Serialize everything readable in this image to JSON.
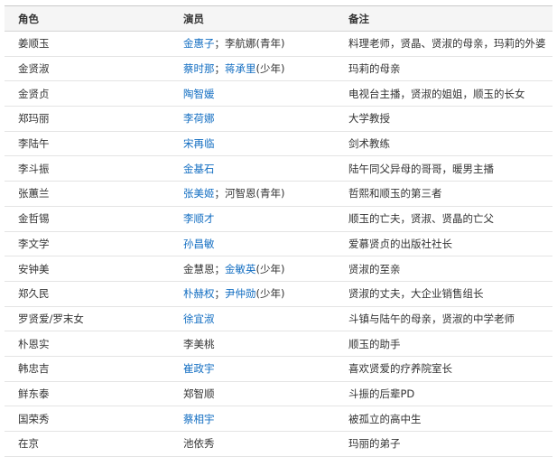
{
  "headers": [
    "角色",
    "演员",
    "备注"
  ],
  "colors": {
    "link": "#136ec2",
    "text": "#333333",
    "header_bg": "#f5f5f5",
    "line": "#e4e4e4"
  },
  "rows": [
    {
      "role": "姜顺玉",
      "actors": [
        {
          "text": "金惠子",
          "link": true
        },
        {
          "text": "；李航娜(青年)",
          "link": false
        }
      ],
      "note": "料理老师，贤晶、贤淑的母亲，玛莉的外婆"
    },
    {
      "role": "金贤淑",
      "actors": [
        {
          "text": "蔡时那",
          "link": true
        },
        {
          "text": "；",
          "link": false
        },
        {
          "text": "蒋承里",
          "link": true
        },
        {
          "text": "(少年)",
          "link": false
        }
      ],
      "note": "玛莉的母亲"
    },
    {
      "role": "金贤贞",
      "actors": [
        {
          "text": "陶智媛",
          "link": true
        }
      ],
      "note": "电视台主播，贤淑的姐姐，顺玉的长女"
    },
    {
      "role": "郑玛丽",
      "actors": [
        {
          "text": "李荷娜",
          "link": true
        }
      ],
      "note": "大学教授"
    },
    {
      "role": "李陆午",
      "actors": [
        {
          "text": "宋再临",
          "link": true
        }
      ],
      "note": "剑术教练"
    },
    {
      "role": "李斗振",
      "actors": [
        {
          "text": "金基石",
          "link": true
        }
      ],
      "note": "陆午同父异母的哥哥，暖男主播"
    },
    {
      "role": "张蕙兰",
      "actors": [
        {
          "text": "张美姬",
          "link": true
        },
        {
          "text": "；河智恩(青年)",
          "link": false
        }
      ],
      "note": "哲熙和顺玉的第三者"
    },
    {
      "role": "金哲锡",
      "actors": [
        {
          "text": "李顺才",
          "link": true
        }
      ],
      "note": "顺玉的亡夫，贤淑、贤晶的亡父"
    },
    {
      "role": "李文学",
      "actors": [
        {
          "text": "孙昌敏",
          "link": true
        }
      ],
      "note": "爱慕贤贞的出版社社长"
    },
    {
      "role": "安钟美",
      "actors": [
        {
          "text": "金慧恩",
          "link": false
        },
        {
          "text": "；",
          "link": false
        },
        {
          "text": "金敏英",
          "link": true
        },
        {
          "text": "(少年)",
          "link": false
        }
      ],
      "note": "贤淑的至亲"
    },
    {
      "role": "郑久民",
      "actors": [
        {
          "text": "朴赫权",
          "link": true
        },
        {
          "text": "；",
          "link": false
        },
        {
          "text": "尹仲勋",
          "link": true
        },
        {
          "text": "(少年)",
          "link": false
        }
      ],
      "note": "贤淑的丈夫，大企业销售组长"
    },
    {
      "role": "罗贤爱/罗末女",
      "actors": [
        {
          "text": "徐宜淑",
          "link": true
        }
      ],
      "note": "斗镇与陆午的母亲，贤淑的中学老师"
    },
    {
      "role": "朴恩实",
      "actors": [
        {
          "text": "李美桃",
          "link": false
        }
      ],
      "note": "顺玉的助手"
    },
    {
      "role": "韩忠吉",
      "actors": [
        {
          "text": "崔政宇",
          "link": true
        }
      ],
      "note": "喜欢贤爱的疗养院室长"
    },
    {
      "role": "鲜东泰",
      "actors": [
        {
          "text": "郑智顺",
          "link": false
        }
      ],
      "note": "斗振的后辈PD"
    },
    {
      "role": "国荣秀",
      "actors": [
        {
          "text": "蔡相宇",
          "link": true
        }
      ],
      "note": "被孤立的高中生"
    },
    {
      "role": "在京",
      "actors": [
        {
          "text": "池依秀",
          "link": false
        }
      ],
      "note": "玛丽的弟子"
    }
  ]
}
